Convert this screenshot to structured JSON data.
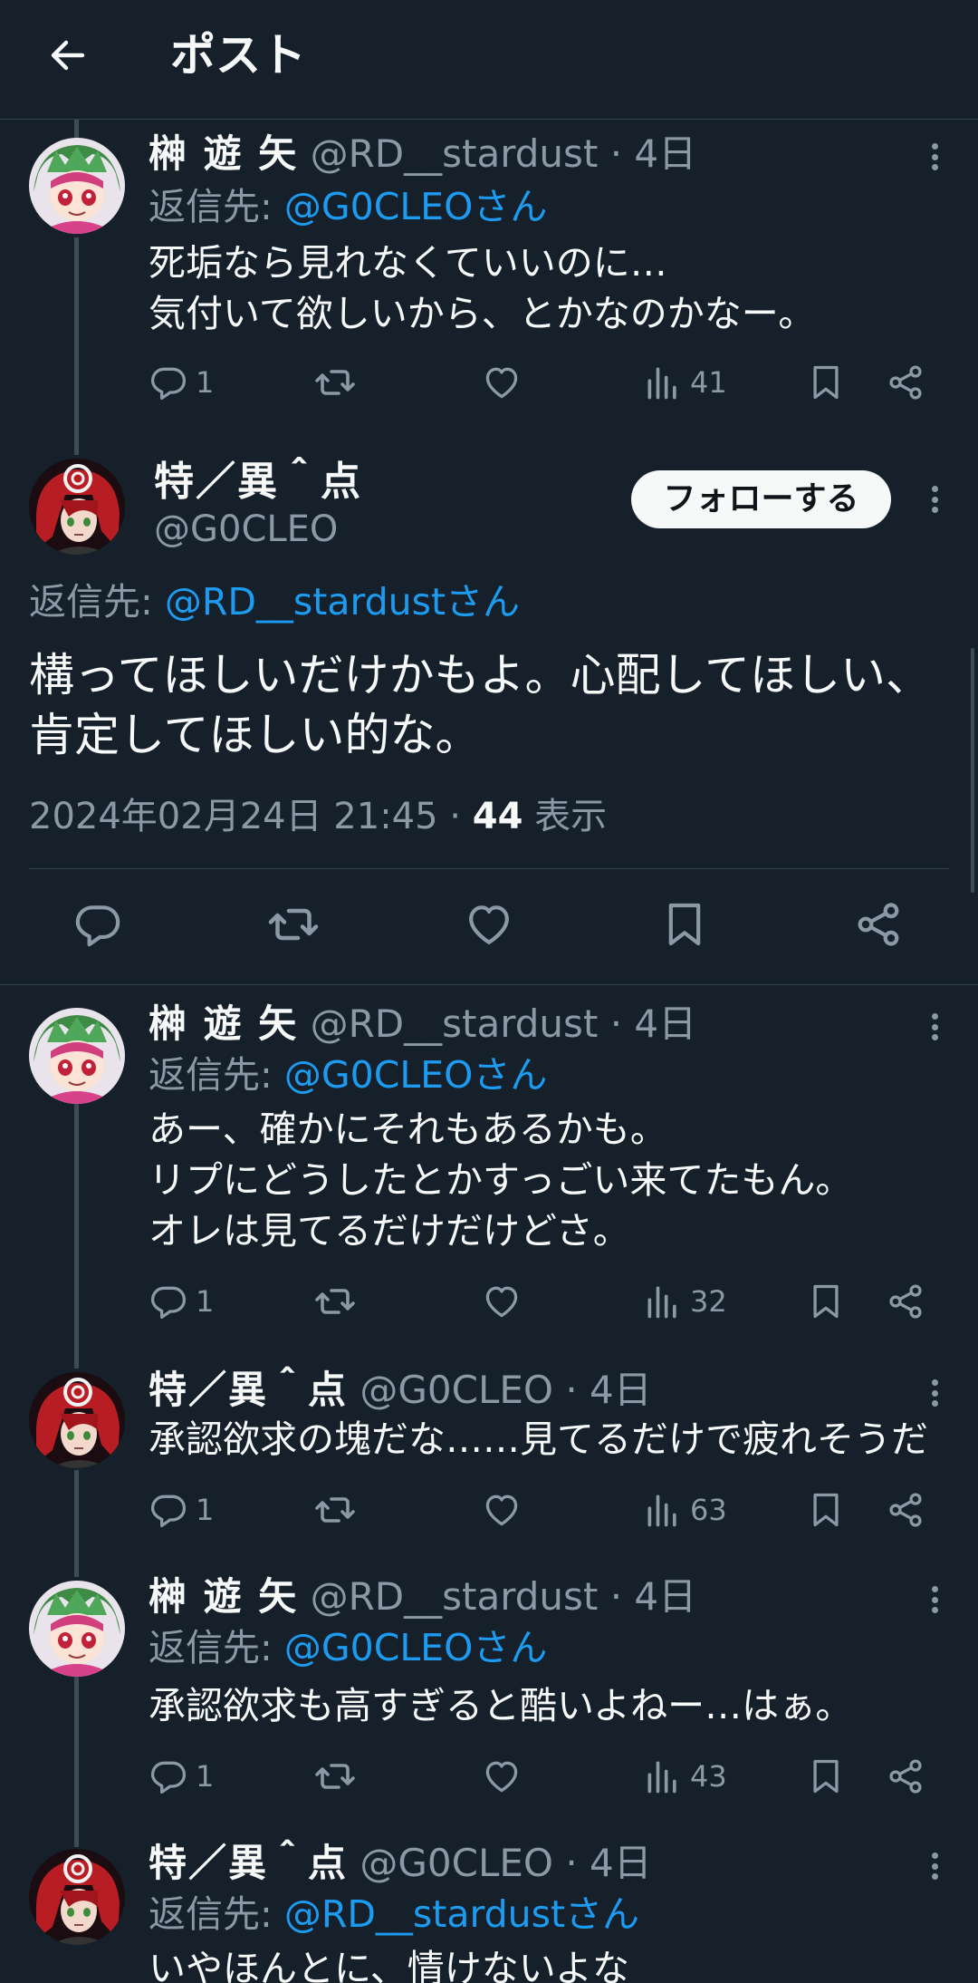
{
  "header": {
    "title": "ポスト"
  },
  "colors": {
    "background": "#15202b",
    "accent": "#1d9bf0",
    "muted": "#8b98a5",
    "text": "#f7f9f9"
  },
  "posts": [
    {
      "name": "榊 遊 矢",
      "handle": "@RD__stardust · 4日",
      "reply_label": "返信先: ",
      "reply_target": "@G0CLEOさん",
      "lines": [
        "死垢なら見れなくていいのに…",
        "気付いて欲しいから、とかなのかなー。"
      ],
      "replies": "1",
      "views": "41"
    },
    {
      "name": "榊 遊 矢",
      "handle": "@RD__stardust · 4日",
      "reply_label": "返信先: ",
      "reply_target": "@G0CLEOさん",
      "lines": [
        "あー、確かにそれもあるかも。",
        "リプにどうしたとかすっごい来てたもん。",
        "オレは見てるだけだけどさ。"
      ],
      "replies": "1",
      "views": "32"
    },
    {
      "name": "特／異＾点",
      "handle": "@G0CLEO · 4日",
      "lines": [
        "承認欲求の塊だな……見てるだけで疲れそうだ"
      ],
      "replies": "1",
      "views": "63"
    },
    {
      "name": "榊 遊 矢",
      "handle": "@RD__stardust · 4日",
      "reply_label": "返信先: ",
      "reply_target": "@G0CLEOさん",
      "lines": [
        "承認欲求も高すぎると酷いよねー…はぁ。"
      ],
      "replies": "1",
      "views": "43"
    },
    {
      "name": "特／異＾点",
      "handle": "@G0CLEO · 4日",
      "reply_label": "返信先: ",
      "reply_target": "@RD__stardustさん",
      "lines": [
        "いやほんとに、情けないよな"
      ]
    }
  ],
  "focus": {
    "name": "特／異＾点",
    "handle": "@G0CLEO",
    "follow_label": "フォローする",
    "reply_label": "返信先: ",
    "reply_target": "@RD__stardustさん",
    "lines": [
      "構ってほしいだけかもよ。心配してほしい、",
      "肯定してほしい的な。"
    ],
    "timestamp": "2024年02月24日 21:45 · ",
    "views_count": "44",
    "views_label": " 表示"
  },
  "icons": [
    "back-arrow-icon",
    "reply-icon",
    "repost-icon",
    "like-icon",
    "views-icon",
    "bookmark-icon",
    "share-icon",
    "more-icon"
  ]
}
